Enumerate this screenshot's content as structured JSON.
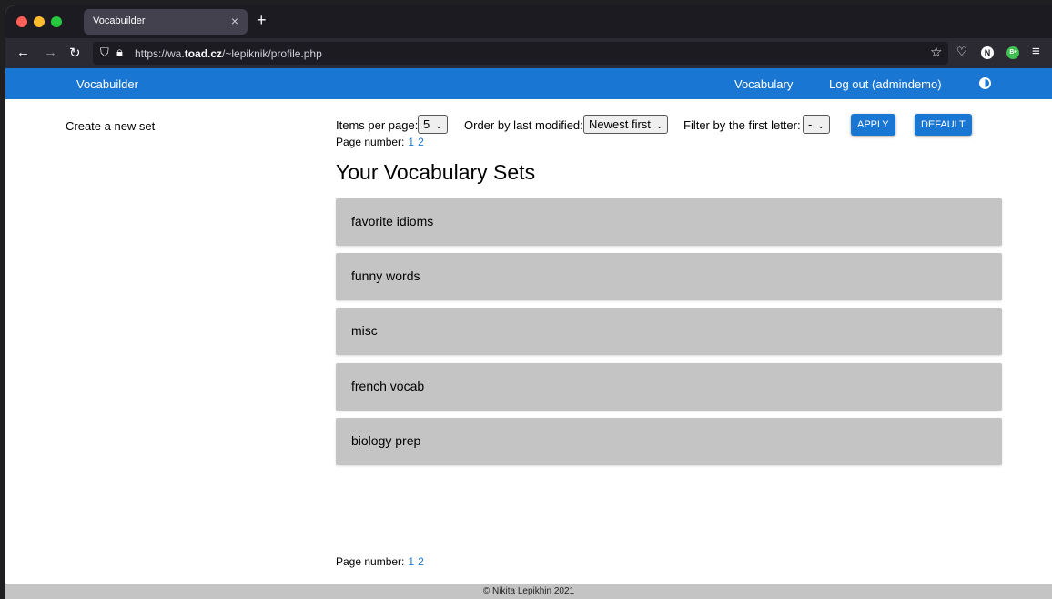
{
  "browser": {
    "tab_title": "Vocabuilder",
    "tab_close": "×",
    "new_tab": "+",
    "url_prefix": "https://wa.",
    "url_host": "toad.cz",
    "url_path": "/~lepiknik/profile.php",
    "ext1": "N",
    "ext2": "B•"
  },
  "header": {
    "brand": "Vocabuilder",
    "nav_vocabulary": "Vocabulary",
    "nav_logout": "Log out (admindemo)"
  },
  "sidebar": {
    "create_link": "Create a new set"
  },
  "controls": {
    "items_per_page_label": "Items per page:",
    "items_per_page_value": "5",
    "order_label": "Order by last modified:",
    "order_value": "Newest first",
    "filter_label": "Filter by the first letter:",
    "filter_value": "-",
    "apply_label": "APPLY",
    "default_label": "DEFAULT"
  },
  "pagination": {
    "label": "Page number:",
    "pages": [
      "1",
      "2"
    ]
  },
  "main": {
    "heading": "Your Vocabulary Sets",
    "sets": [
      "favorite idioms",
      "funny words",
      "misc",
      "french vocab",
      "biology prep"
    ]
  },
  "footer": {
    "text": "© Nikita Lepikhin 2021"
  }
}
